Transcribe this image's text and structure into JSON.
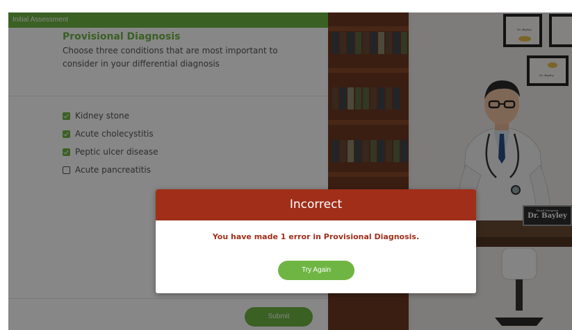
{
  "panel": {
    "header": "Initial Assessment",
    "section_title": "Provisional Diagnosis",
    "section_description": "Choose three conditions that are most important to consider in your differential diagnosis",
    "options": [
      {
        "label": "Kidney stone",
        "checked": true
      },
      {
        "label": "Acute cholecystitis",
        "checked": true
      },
      {
        "label": "Peptic ulcer disease",
        "checked": true
      },
      {
        "label": "Acute pancreatitis",
        "checked": false
      }
    ],
    "submit_label": "Submit"
  },
  "scene": {
    "nameplate_title": "Head Surgeon",
    "nameplate_name": "Dr. Bayley",
    "diploma_text": "Dr. Bayley"
  },
  "dialog": {
    "title": "Incorrect",
    "message": "You have made 1 error in Provisional Diagnosis.",
    "button_label": "Try Again"
  },
  "colors": {
    "accent_green": "#6fb543",
    "error_red": "#a02e19",
    "bookshelf_brown": "#6e3a22"
  }
}
